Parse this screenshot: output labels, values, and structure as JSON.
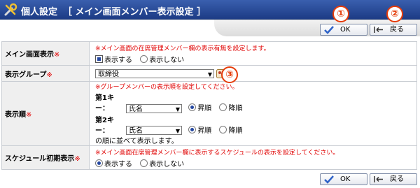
{
  "header": {
    "title": "個人設定",
    "subtitle": "［ メイン画面メンバー表示設定 ］"
  },
  "toolbar": {
    "ok_label": "OK",
    "back_label": "戻る"
  },
  "markers": {
    "m1": "①",
    "m2": "②",
    "m3": "③"
  },
  "rows": {
    "main_display": {
      "label": "メイン画面表示",
      "req": "※",
      "note": "※メイン画面の在席管理メンバー欄の表示有無を設定します。",
      "opt_show": "表示する",
      "opt_hide": "表示しない",
      "selected": "表示する"
    },
    "group": {
      "label": "表示グループ",
      "req": "※",
      "value": "取締役"
    },
    "order": {
      "label": "表示順",
      "req": "※",
      "note": "※グループメンバーの表示順を設定してください。",
      "key1_label": "第1キー：",
      "key1_value": "氏名",
      "key2_label": "第2キー：",
      "key2_value": "氏名",
      "asc": "昇順",
      "desc": "降順",
      "suffix": "の順に並べて表示します。"
    },
    "schedule": {
      "label": "スケジュール初期表示",
      "req": "※",
      "note": "※メイン画面在席管理メンバー欄に表示するスケジュールの表示を設定してください。",
      "opt_show": "表示する",
      "opt_hide": "表示しない",
      "selected": "表示する"
    }
  },
  "colors": {
    "header": "#2a4c9a",
    "required": "#e00000",
    "marker": "#e53b08"
  }
}
